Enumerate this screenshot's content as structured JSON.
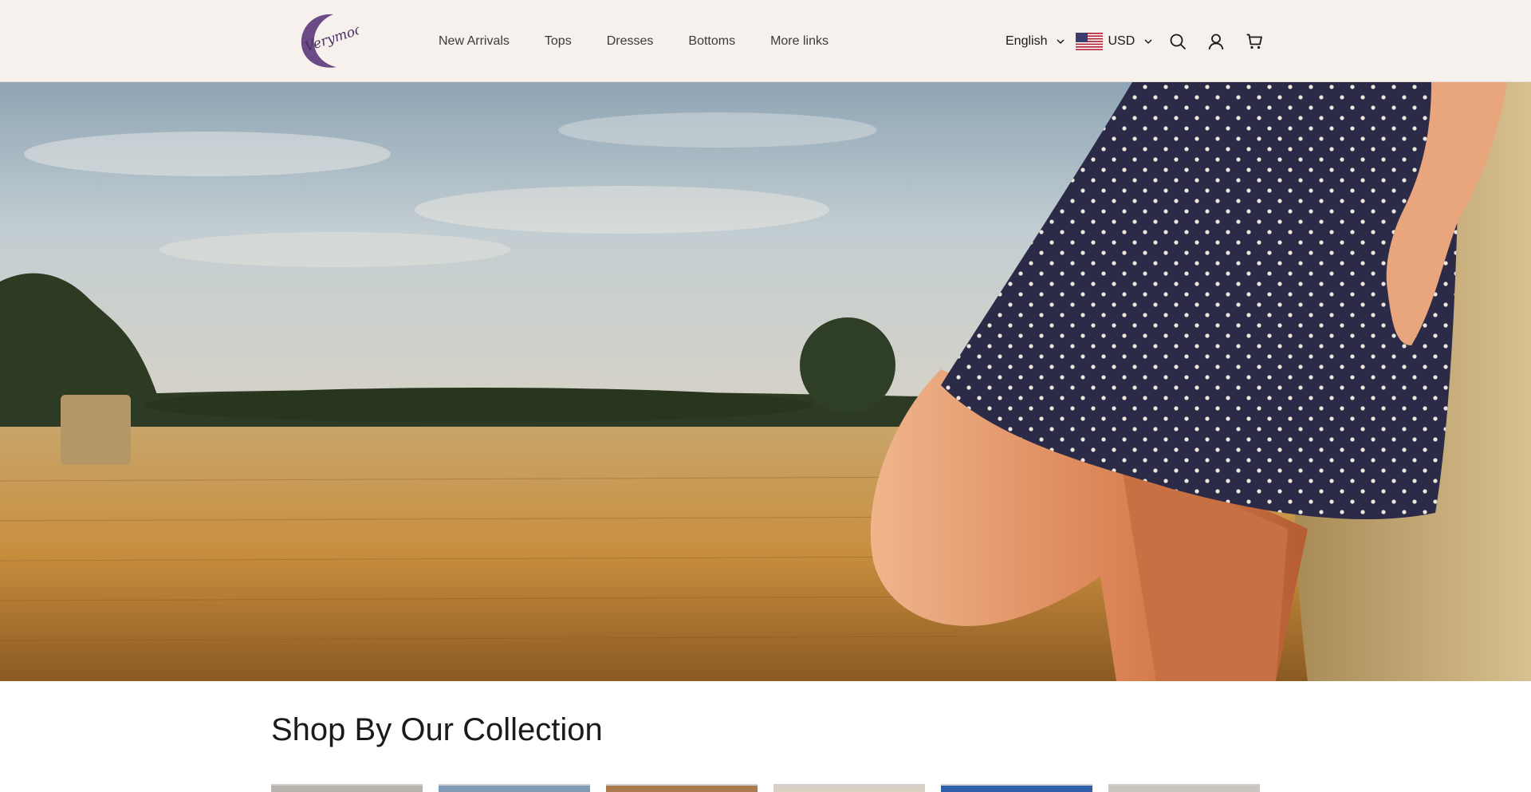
{
  "brand": {
    "logo_alt": "Verymoon",
    "logo_text": "Verymoon",
    "colors": {
      "logo": "#6b4a86",
      "header_bg": "#f6f1ec",
      "text": "#1a1a1a"
    }
  },
  "nav": {
    "items": [
      {
        "label": "New Arrivals"
      },
      {
        "label": "Tops"
      },
      {
        "label": "Dresses"
      },
      {
        "label": "Bottoms"
      },
      {
        "label": "More links"
      }
    ]
  },
  "toolbar": {
    "language": "English",
    "currency": "USD",
    "icons": [
      "chevron-down-icon",
      "us-flag-icon",
      "search-icon",
      "account-icon",
      "cart-icon"
    ]
  },
  "hero": {
    "image_alt": "Woman in polka dot dress leaning on a hay bale in a wheat field"
  },
  "collection": {
    "title": "Shop By Our Collection",
    "tiles": [
      {
        "color": "#b8b4ad"
      },
      {
        "color": "#7f9bb8"
      },
      {
        "color": "#a97b4e"
      },
      {
        "color": "#d8d2c4"
      },
      {
        "color": "#2f5fa8"
      },
      {
        "color": "#c9c5bf"
      }
    ]
  }
}
